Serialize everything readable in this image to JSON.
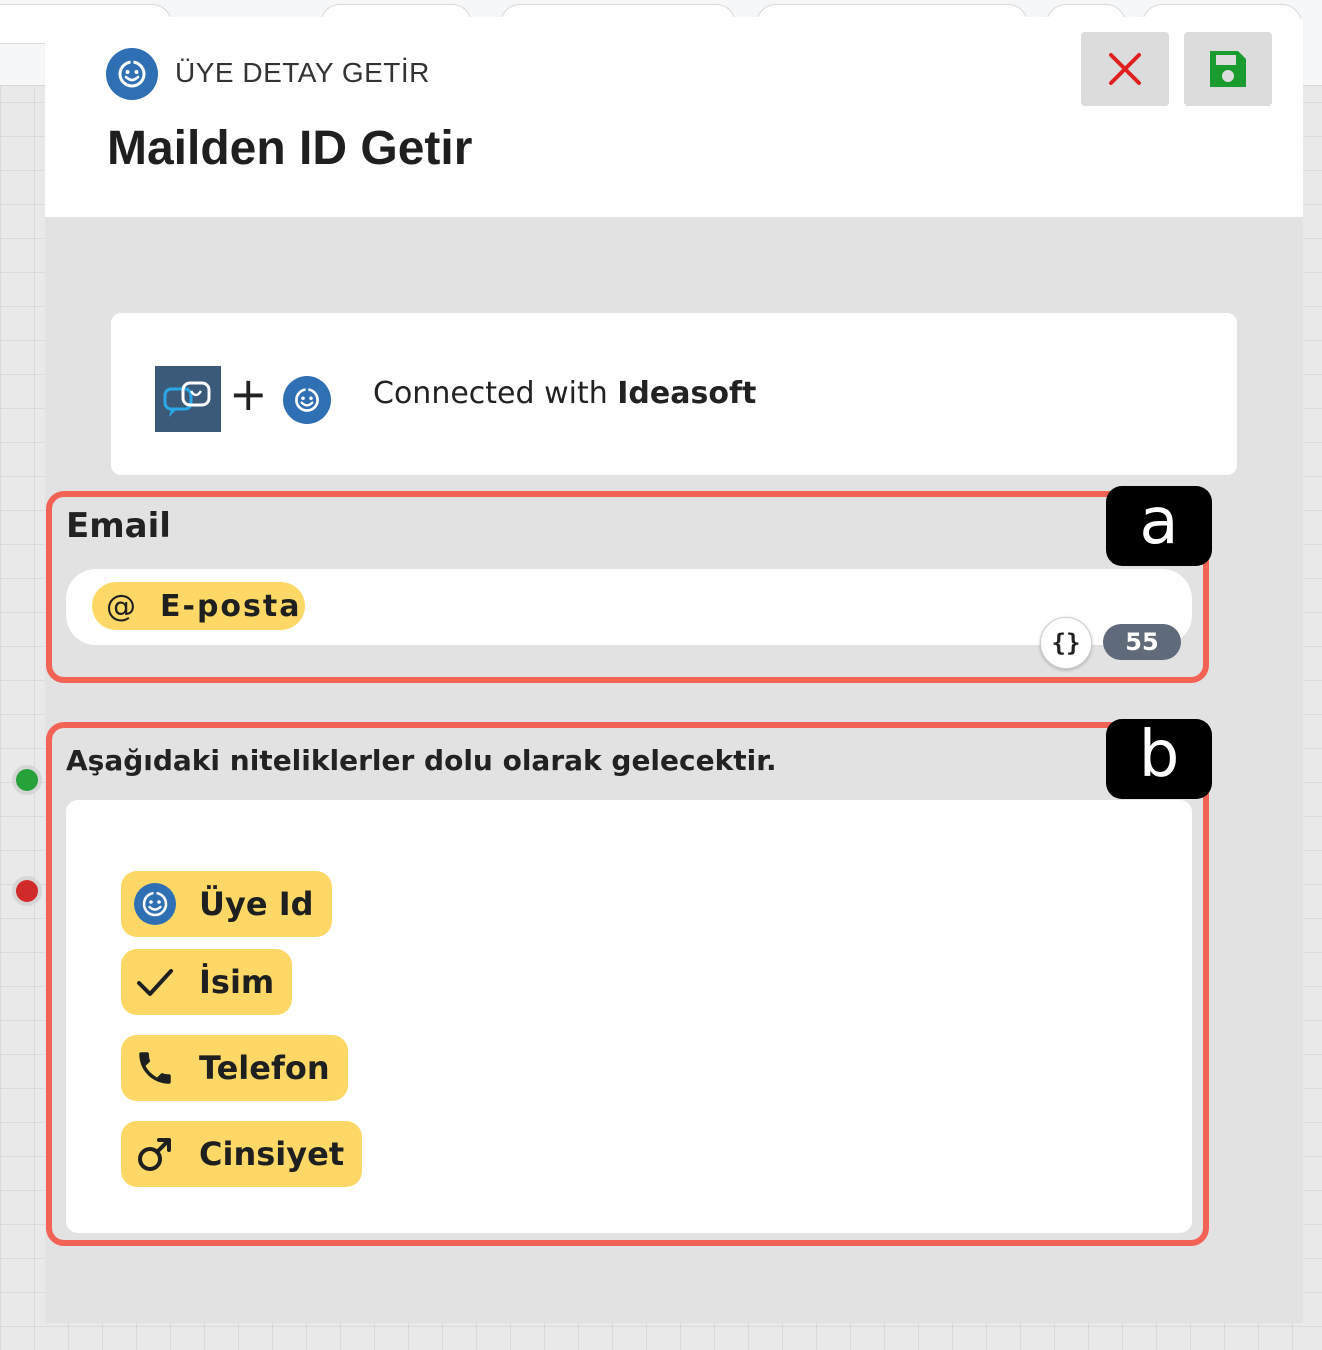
{
  "modal": {
    "subtitle": "ÜYE DETAY GETİR",
    "title": "Mailden ID Getir"
  },
  "connection": {
    "prefix": "Connected with ",
    "service": "Ideasoft"
  },
  "email_section": {
    "marker": "a",
    "label": "Email",
    "chip_label": "E-posta",
    "chip_icon": "@",
    "variable_icon": "{}",
    "count": "55"
  },
  "attributes_section": {
    "marker": "b",
    "label": "Aşağıdaki niteliklerler dolu olarak gelecektir.",
    "items": [
      {
        "label": "Üye Id",
        "icon": "ideasoft-logo-icon"
      },
      {
        "label": "İsim",
        "icon": "check-icon"
      },
      {
        "label": "Telefon",
        "icon": "phone-icon"
      },
      {
        "label": "Cinsiyet",
        "icon": "gender-male-icon"
      }
    ]
  },
  "colors": {
    "brand_blue": "#2f6fb3",
    "chip_yellow": "#fdd866",
    "highlight_red": "#f26355",
    "close_red": "#e02020",
    "save_green": "#1a9b2d"
  }
}
